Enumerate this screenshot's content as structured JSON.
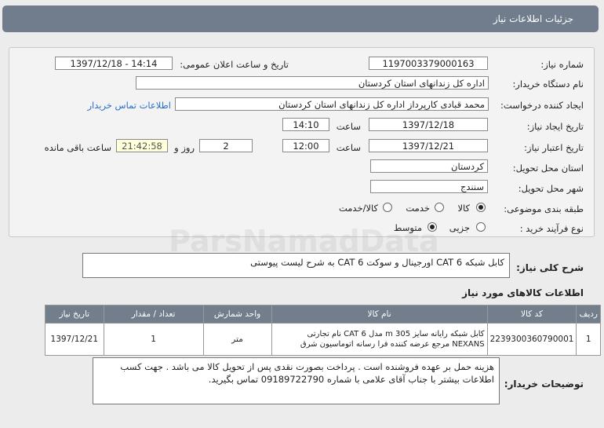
{
  "header": {
    "title": "جزئیات اطلاعات نیاز"
  },
  "form": {
    "need_number_label": "شماره نیاز:",
    "need_number": "1197003379000163",
    "announce_label": "تاریخ و ساعت اعلان عمومی:",
    "announce_value": "1397/12/18 - 14:14",
    "buyer_org_label": "نام دستگاه خریدار:",
    "buyer_org": "اداره کل زندانهای استان کردستان",
    "requester_label": "ایجاد کننده درخواست:",
    "requester": "محمد  قبادی کارپرداز اداره کل زندانهای استان کردستان",
    "contact_link": "اطلاعات تماس خریدار",
    "created_label": "تاریخ ایجاد نیاز:",
    "created_date": "1397/12/18",
    "time_label": "ساعت",
    "created_time": "14:10",
    "valid_label": "تاریخ اعتبار نیاز:",
    "valid_date": "1397/12/21",
    "valid_time": "12:00",
    "days": "2",
    "days_label": "روز و",
    "remaining": "21:42:58",
    "remaining_label": "ساعت باقی مانده",
    "province_label": "استان محل تحویل:",
    "province": "کردستان",
    "city_label": "شهر محل تحویل:",
    "city": "سنندج",
    "category_label": "طبقه بندی موضوعی:",
    "category_options": [
      "کالا",
      "خدمت",
      "کالا/خدمت"
    ],
    "category_selected": 0,
    "process_label": "نوع فرآیند خرید :",
    "process_options": [
      "جزیی",
      "متوسط"
    ],
    "process_selected": 1
  },
  "summary": {
    "label": "شرح کلی نیاز:",
    "text": "کابل شبکه CAT 6 اورجینال و سوکت CAT 6  به شرح لیست پیوستی"
  },
  "goods": {
    "section_title": "اطلاعات کالاهای مورد نیاز",
    "columns": [
      "ردیف",
      "کد کالا",
      "نام کالا",
      "واحد شمارش",
      "تعداد / مقدار",
      "تاریخ نیاز"
    ],
    "rows": [
      {
        "row": "1",
        "code": "2239300360790001",
        "name": "کابل شبکه رایانه سایز 305 m مدل CAT 6 نام تجارتی NEXANS مرجع عرضه کننده فرا رسانه اتوماسیون شرق",
        "unit": "متر",
        "qty": "1",
        "date": "1397/12/21"
      }
    ]
  },
  "buyer_notes": {
    "label": "توضیحات خریدار:",
    "text": "هزینه حمل بر عهده فروشنده است . پرداخت بصورت نقدی پس از تحویل کالا می باشد . جهت کسب اطلاعات بیشتر با جناب آقای علامی با شماره  09189722790 تماس بگیرید."
  },
  "watermark": {
    "text": "ParsNamadData"
  }
}
